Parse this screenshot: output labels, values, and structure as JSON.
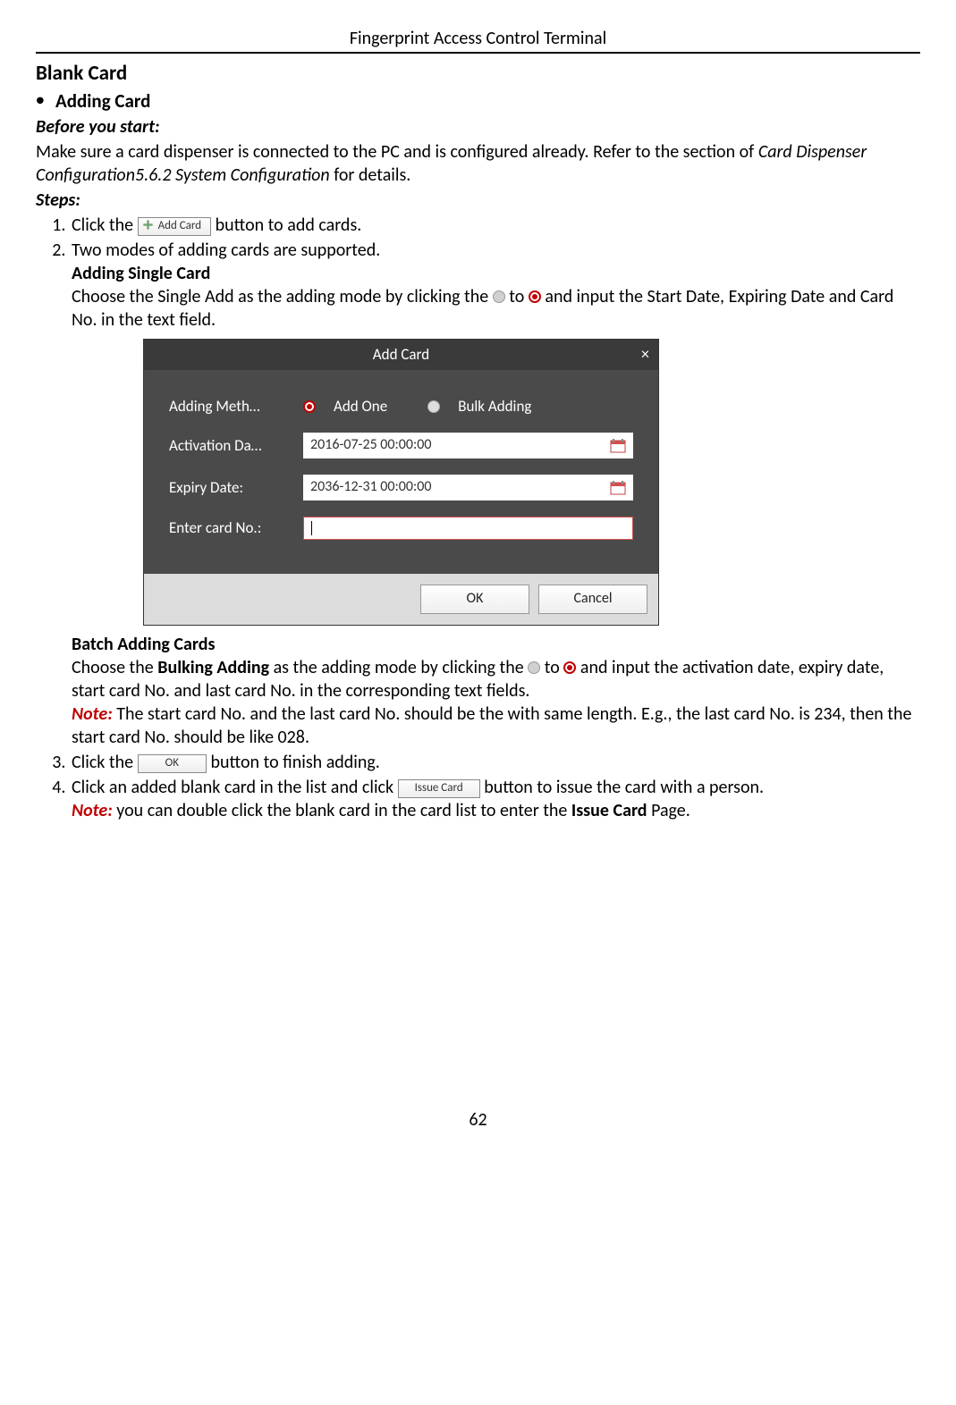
{
  "header": "Fingerprint Access Control Terminal",
  "section_title": "Blank Card",
  "bullet_title": "Adding Card",
  "before_label": "Before you start:",
  "before_text_1": "Make sure a card dispenser is connected to the PC and is configured already. Refer to the section of ",
  "before_text_italic": "Card Dispenser Configuration5.6.2 System Configuration",
  "before_text_2": " for details.",
  "steps_label": "Steps:",
  "step1_a": "Click the ",
  "step1_b": " button to add cards.",
  "add_card_btn": "Add Card",
  "step2_intro": "Two modes of adding cards are supported.",
  "single_heading": "Adding Single Card",
  "single_text_a": "Choose the Single Add as the adding mode by clicking the ",
  "single_text_b": " to ",
  "single_text_c": " and input the Start Date, Expiring Date and Card No. in the text field.",
  "dialog": {
    "title": "Add Card",
    "label_method": "Adding Meth…",
    "opt_add_one": "Add One",
    "opt_bulk": "Bulk Adding",
    "label_activation": "Activation Da…",
    "value_activation": "2016-07-25 00:00:00",
    "label_expiry": "Expiry Date:",
    "value_expiry": "2036-12-31 00:00:00",
    "label_cardno": "Enter card No.:",
    "btn_ok": "OK",
    "btn_cancel": "Cancel"
  },
  "batch_heading": "Batch Adding Cards",
  "batch_text_a": "Choose the ",
  "batch_text_bold": "Bulking Adding",
  "batch_text_b": " as the adding mode by clicking the ",
  "batch_text_c": " to ",
  "batch_text_d": " and input the activation date, expiry date, start card No. and last card No. in the corresponding text fields.",
  "note_label": "Note:",
  "batch_note": " The start card No. and the last card No. should be the with same length. E.g., the last card No. is 234, then the start card No. should be like 028.",
  "step3_a": "Click the ",
  "step3_b": " button to finish adding.",
  "ok_btn": "OK",
  "step4_a": "Click an added blank card in the list and click ",
  "step4_b": " button to issue the card with a person.",
  "issue_btn": "Issue Card",
  "step4_note_a": " you can double click the blank card in the card list to enter the ",
  "step4_note_bold": "Issue Card",
  "step4_note_b": " Page.",
  "page_number": "62"
}
